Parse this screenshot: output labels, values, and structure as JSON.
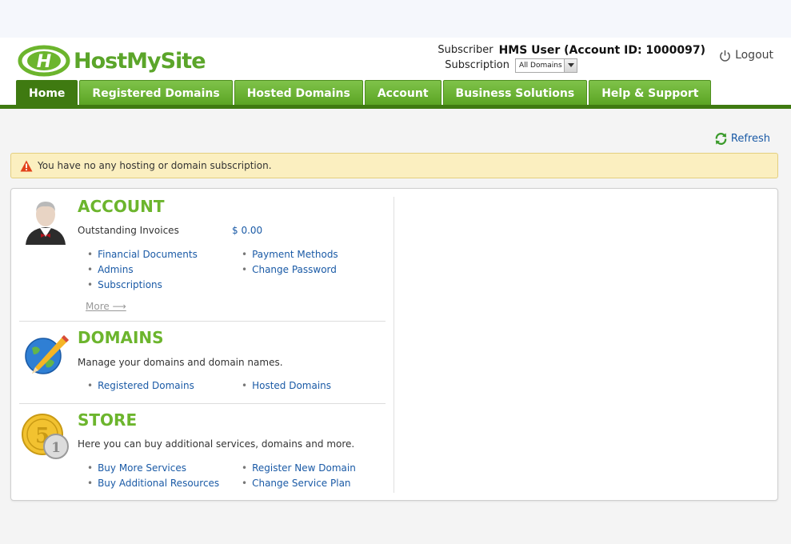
{
  "brand": {
    "name": "HostMySite",
    "logo_letter": "H"
  },
  "header": {
    "subscriber_label": "Subscriber",
    "subscriber_value": "HMS User (Account ID: 1000097)",
    "subscription_label": "Subscription",
    "subscription_selected": "All Domains",
    "logout_label": "Logout"
  },
  "nav": {
    "tabs": [
      {
        "label": "Home",
        "active": true
      },
      {
        "label": "Registered Domains"
      },
      {
        "label": "Hosted Domains"
      },
      {
        "label": "Account"
      },
      {
        "label": "Business Solutions"
      },
      {
        "label": "Help & Support"
      }
    ]
  },
  "toolbar": {
    "refresh_label": "Refresh"
  },
  "alert": {
    "message": "You have no any hosting or domain subscription."
  },
  "account": {
    "title": "ACCOUNT",
    "outstanding_label": "Outstanding Invoices",
    "outstanding_value": "$ 0.00",
    "links_left": [
      "Financial Documents",
      "Admins",
      "Subscriptions"
    ],
    "links_right": [
      "Payment Methods",
      "Change Password"
    ],
    "more_label": "More ⟶"
  },
  "domains": {
    "title": "DOMAINS",
    "description": "Manage your domains and domain names.",
    "links_left": [
      "Registered Domains"
    ],
    "links_right": [
      "Hosted Domains"
    ]
  },
  "store": {
    "title": "STORE",
    "description": "Here you can buy additional services, domains and more.",
    "links_left": [
      "Buy More Services",
      "Buy Additional Resources"
    ],
    "links_right": [
      "Register New Domain",
      "Change Service Plan"
    ]
  },
  "colors": {
    "brand_green": "#5ba52a",
    "nav_active": "#3f7a11",
    "link_blue": "#1a5aa6",
    "alert_bg": "#fbefc0"
  }
}
